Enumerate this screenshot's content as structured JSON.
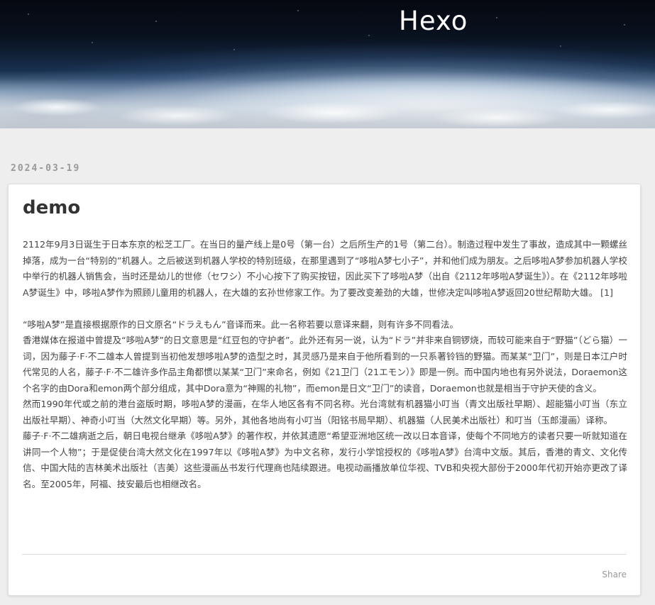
{
  "site": {
    "title": "Hexo"
  },
  "post": {
    "date": "2024-03-19",
    "title": "demo",
    "paragraphs": [
      "2112年9月3日诞生于日本东京的松芝工厂。在当日的量产线上是0号（第一台）之后所生产的1号（第二台）。制造过程中发生了事故，造成其中一颗螺丝掉落，成为一台“特别的”机器人。之后被送到机器人学校的特别班级，在那里遇到了“哆啦A梦七小子”，并和他们成为朋友。之后哆啦A梦参加机器人学校中举行的机器人销售会，当时还是幼儿的世修（セワシ）不小心按下了购买按钮，因此买下了哆啦A梦（出自《2112年哆啦A梦诞生》）。在《2112年哆啦A梦诞生》中，哆啦A梦作为照顾儿童用的机器人，在大雄的玄孙世修家工作。为了要改变差劲的大雄，世修决定叫哆啦A梦返回20世纪帮助大雄。",
      "“哆啦A梦”是直接根据原作的日文原名“ドラえもん”音译而来。此一名称若要以意译来翻，则有许多不同看法。",
      "香港媒体在报道中曾提及“哆啦A梦”的日文意思是“红豆包的守护者”。此外还有另一说，认为“ドラ”并非来自铜锣烧，而较可能来自于“野猫”（どら猫）一词，因为藤子·F·不二雄本人曾提到当初他发想哆啦A梦的造型之时，其灵感乃是来自于他所看到的一只系著铃铛的野猫。而某某“卫门”，则是日本江户时代常见的人名，藤子·F·不二雄许多作品主角都惯以某某“卫门”来命名，例如《21卫门（21エモン）》即是一例。而中国内地也有另外说法，Doraemon这个名字的由Dora和emon两个部分组成，其中Dora意为“神赐的礼物”，而emon是日文“卫门”的读音，Doraemon也就是相当于守护天使的含义。",
      "然而1990年代或之前的港台盗版时期，哆啦A梦的漫画，在华人地区各有不同名称。光台湾就有机器猫小叮当（青文出版社早期）、超能猫小叮当（东立出版社早期）、神奇小叮当（大然文化早期）等。另外，其他各地尚有小叮当（阳铭书局早期）、机器猫（人民美术出版社）和叮当（玉郎漫画）译称。",
      "藤子·F·不二雄病逝之后，朝日电视台继承《哆啦A梦》的著作权，并依其遗愿“希望亚洲地区统一改以日本音译，使每个不同地方的读者只要一听就知道在讲同一个人物”；于是促使台湾大然文化在1997年以《哆啦A梦》为中文名称，发行小学馆授权的《哆啦A梦》台湾中文版。其后，香港的青文、文化传信、中国大陆的吉林美术出版社（吉美）这些漫画丛书发行代理商也陆续跟进。电视动画播放单位华视、TVB和央视大部份于2000年代初开始亦更改了译名。至2005年，阿福、技安最后也相继改名。"
    ],
    "reference": "[1]",
    "share_label": "Share"
  },
  "colors": {
    "page_background": "#eeeeee",
    "card_background": "#ffffff",
    "text": "#444444",
    "title": "#333333",
    "muted": "#999999"
  }
}
